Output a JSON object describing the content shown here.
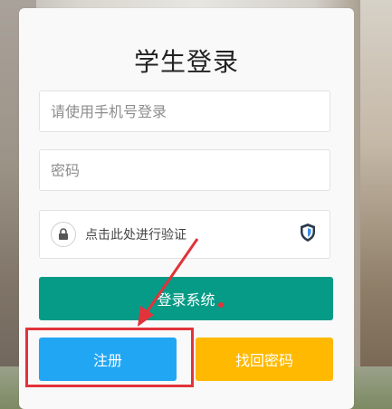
{
  "login": {
    "title": "学生登录",
    "phone_placeholder": "请使用手机号登录",
    "password_placeholder": "密码",
    "verify_text": "点击此处进行验证",
    "login_button": "登录系统",
    "register_button": "注册",
    "forgot_button": "找回密码"
  },
  "icons": {
    "lock": "lock-icon",
    "shield": "shield-icon",
    "arrow": "arrow-annotation"
  },
  "colors": {
    "login_button": "#059b86",
    "register_button": "#21a6f4",
    "forgot_button": "#ffb900",
    "annotation": "#e2333a"
  }
}
